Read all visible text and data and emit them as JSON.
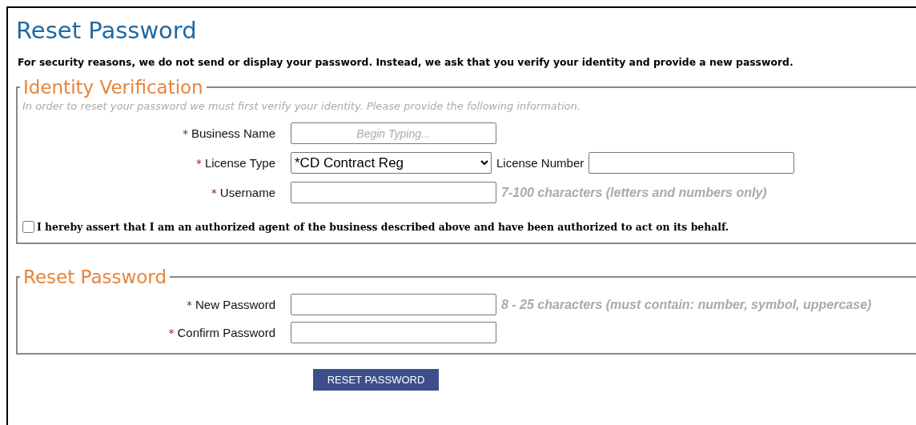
{
  "page": {
    "title": "Reset Password",
    "intro": "For security reasons, we do not send or display your password. Instead, we ask that you verify your identity and provide a new password."
  },
  "sections": [
    {
      "legend": "Identity Verification",
      "note": "In order to reset your password we must first verify your identity. Please provide the following information.",
      "fields": [
        {
          "kind": "text",
          "required_mark": "*",
          "label": "Business Name",
          "placeholder": "Begin Typing..."
        },
        {
          "kind": "select",
          "required_mark": "*",
          "label": "License Type",
          "value": "*CD Contract Reg",
          "extra": {
            "label": "License Number",
            "kind": "text"
          }
        },
        {
          "kind": "text",
          "required_mark": "*",
          "label": "Username",
          "hint": "7-100 characters (letters and numbers only)"
        }
      ],
      "agreement": {
        "checked": false,
        "text": "I hereby assert that I am an authorized agent of the business described above and have been authorized to act on its behalf."
      }
    },
    {
      "legend": "Reset Password",
      "fields": [
        {
          "kind": "password",
          "required_mark": "*",
          "label": "New Password",
          "hint": "8 - 25 characters (must contain: number, symbol, uppercase)"
        },
        {
          "kind": "password",
          "required_mark": "*",
          "label": "Confirm Password"
        }
      ]
    }
  ],
  "submit_button": "RESET PASSWORD"
}
